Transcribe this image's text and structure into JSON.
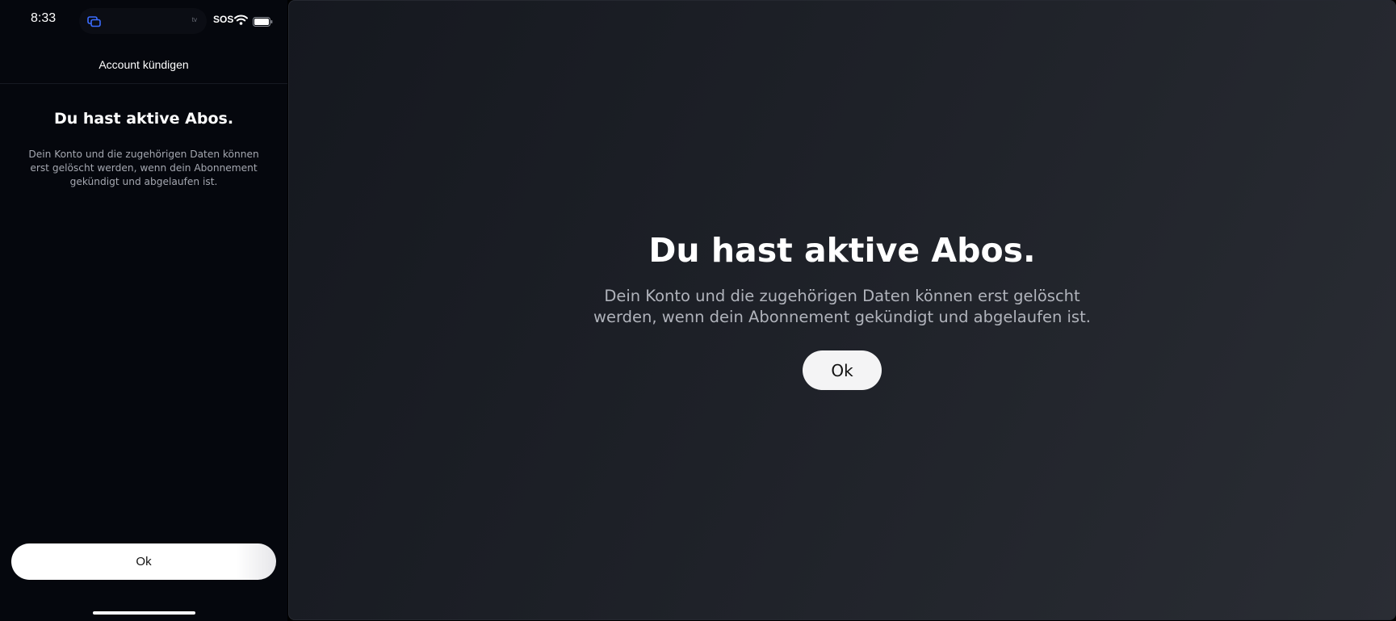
{
  "phone": {
    "status_bar": {
      "time": "8:33",
      "island_label": "tv",
      "sos": "SOS"
    },
    "nav_title": "Account kündigen",
    "heading": "Du hast aktive Abos.",
    "body": "Dein Konto und die zugehörigen Daten können erst gelöscht werden, wenn dein Abonnement gekündigt und abgelaufen ist.",
    "ok_label": "Ok"
  },
  "tv": {
    "title": "Du hast aktive Abos.",
    "body": "Dein Konto und die zugehörigen Daten können erst gelöscht werden, wenn dein Abonnement gekündigt und abgelaufen ist.",
    "ok_label": "Ok"
  },
  "colors": {
    "phone_background": "#05070d",
    "tv_background_start": "#15181f",
    "tv_background_end": "#2a2d34",
    "button_background": "#ffffff",
    "body_text": "#a4a7b0",
    "island_icon": "#3b6cff"
  },
  "icons": {
    "island_app": "copy-app-icon",
    "wifi": "wifi-icon",
    "battery": "battery-icon"
  }
}
